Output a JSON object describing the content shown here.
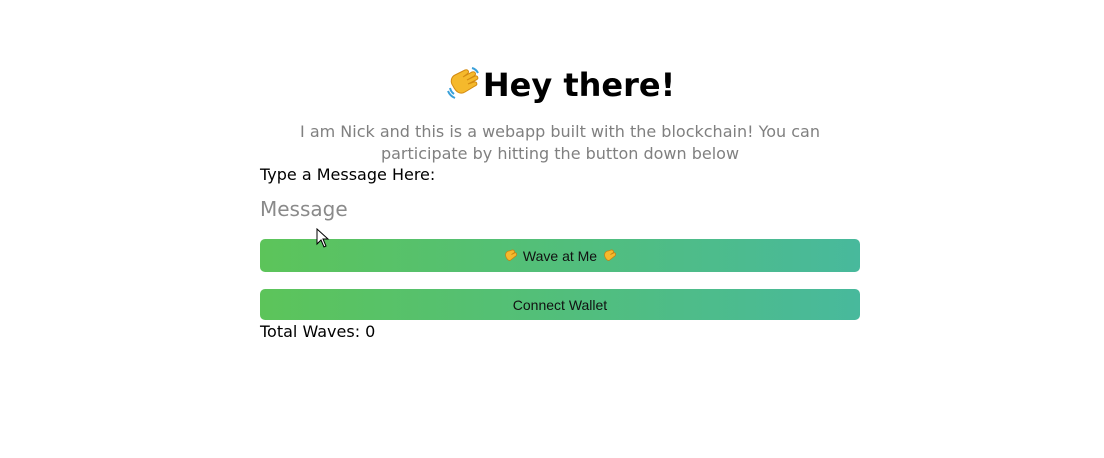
{
  "header": {
    "icon": "waving-hand-icon",
    "title": "Hey there!"
  },
  "bio": "I am Nick and this is a webapp built with the blockchain! You can participate by hitting the button down below",
  "form": {
    "label": "Type a Message Here:",
    "placeholder": "Message",
    "value": ""
  },
  "buttons": {
    "wave_label": "Wave at Me",
    "wave_icon": "clapping-hands-icon",
    "connect_label": "Connect Wallet"
  },
  "stats": {
    "total_waves": "Total Waves: 0"
  },
  "colors": {
    "button_gradient_start": "#5cc45a",
    "button_gradient_end": "#48b99c",
    "bio_text": "#808080"
  }
}
